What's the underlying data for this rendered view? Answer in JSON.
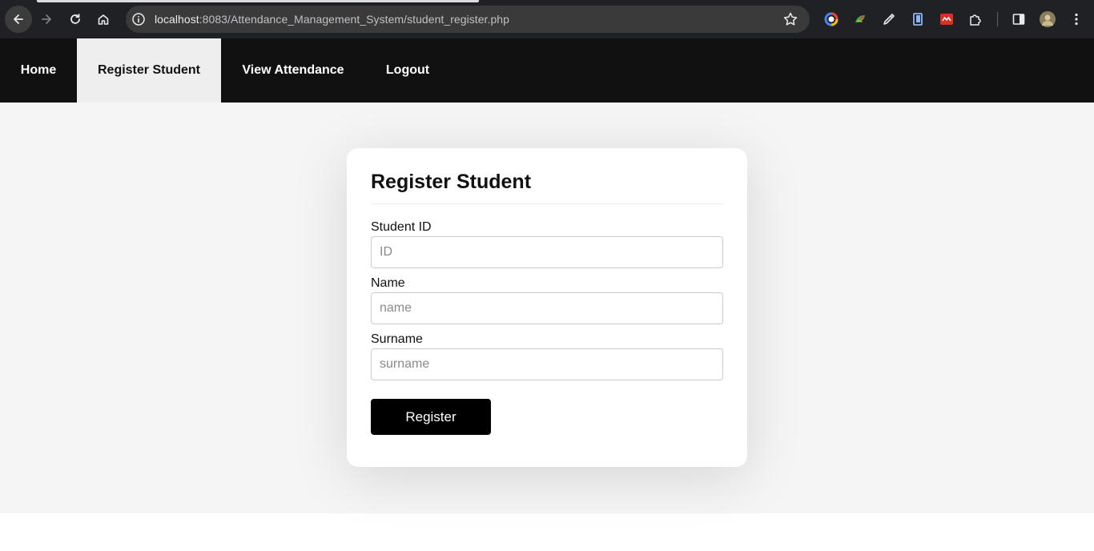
{
  "browser": {
    "url_host": "localhost",
    "url_path": ":8083/Attendance_Management_System/student_register.php",
    "icons": [
      "back-icon",
      "forward-icon",
      "reload-icon",
      "home-icon",
      "site-info-icon",
      "bookmark-star-icon",
      "extensions-icon",
      "side-panel-icon",
      "profile-avatar",
      "menu-icon"
    ]
  },
  "nav": {
    "home": "Home",
    "register": "Register Student",
    "view": "View Attendance",
    "logout": "Logout",
    "active": "Register Student"
  },
  "form": {
    "title": "Register Student",
    "id_label": "Student ID",
    "id_placeholder": "ID",
    "name_label": "Name",
    "name_placeholder": "name",
    "surname_label": "Surname",
    "surname_placeholder": "surname",
    "submit": "Register"
  },
  "colors": {
    "nav_bg": "#111111",
    "nav_active_bg": "#eeeeee",
    "page_bg": "#f5f5f5",
    "button_bg": "#000000"
  }
}
